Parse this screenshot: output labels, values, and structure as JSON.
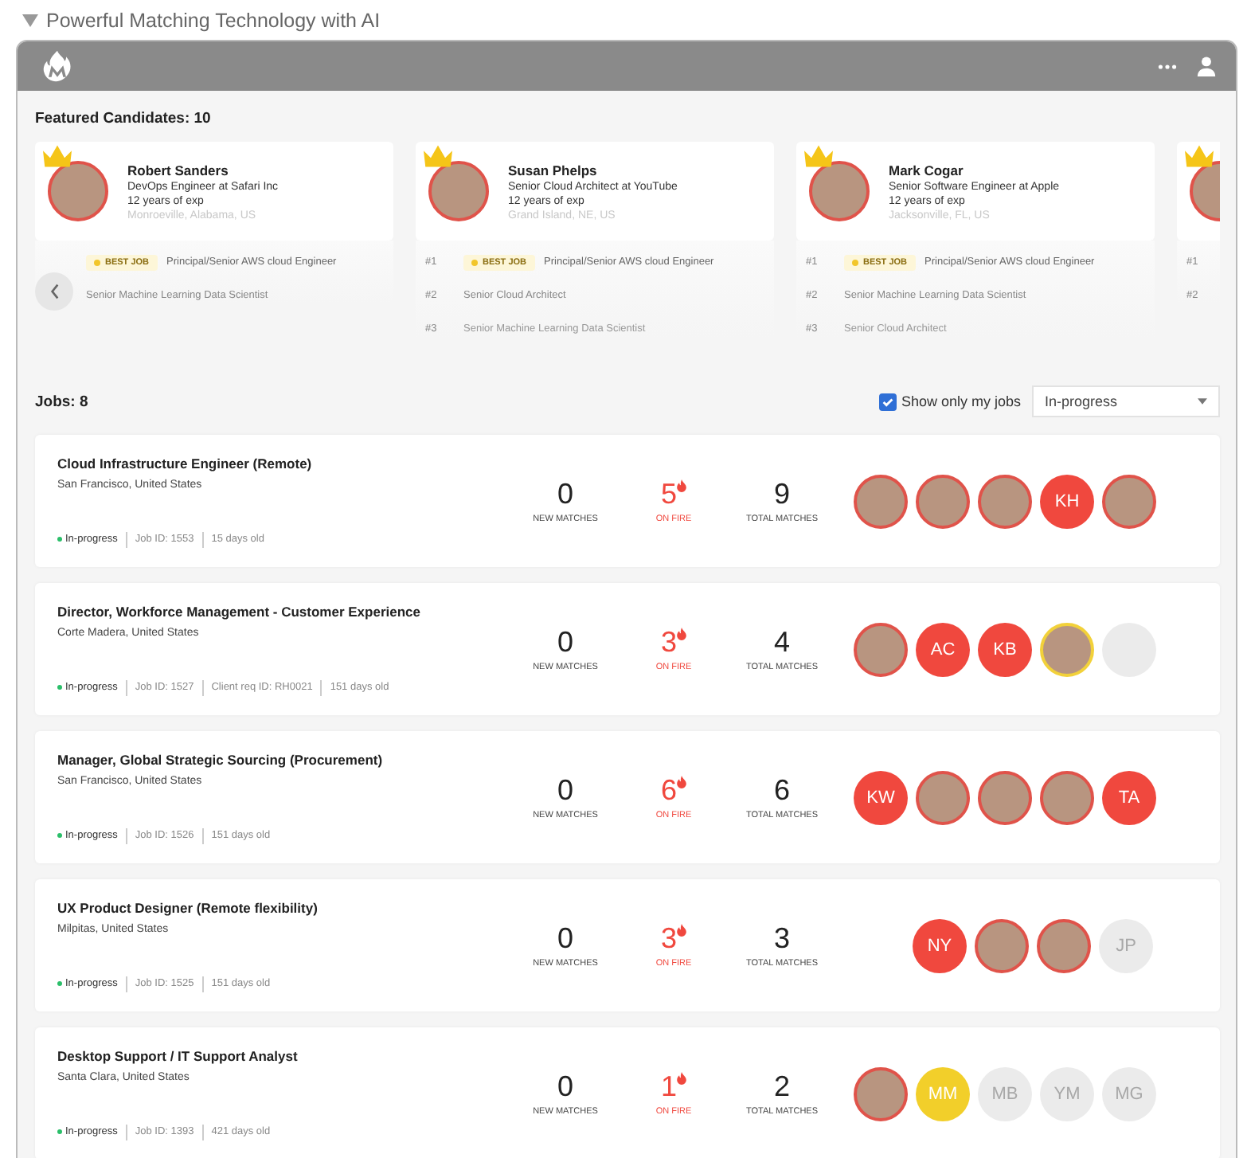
{
  "title": "Powerful Matching Technology with AI",
  "featured": {
    "label": "Featured Candidates: 10",
    "candidates": [
      {
        "name": "Robert Sanders",
        "headline": "DevOps Engineer at Safari Inc",
        "experience": "12 years of exp",
        "location": "Monroeville, Alabama, US",
        "jobs": [
          {
            "badge": "BEST JOB",
            "title": "Principal/Senior AWS cloud Engineer"
          },
          {
            "title": "Senior Machine Learning Data Scientist"
          }
        ]
      },
      {
        "name": "Susan Phelps",
        "headline": "Senior Cloud Architect at YouTube",
        "experience": "12 years of exp",
        "location": "Grand Island, NE, US",
        "jobs": [
          {
            "rank": "#1",
            "badge": "BEST JOB",
            "title": "Principal/Senior AWS cloud Engineer"
          },
          {
            "rank": "#2",
            "title": "Senior Cloud Architect"
          },
          {
            "rank": "#3",
            "title": "Senior Machine Learning Data Scientist"
          }
        ]
      },
      {
        "name": "Mark Cogar",
        "headline": "Senior Software Engineer at Apple",
        "experience": "12 years of exp",
        "location": "Jacksonville, FL, US",
        "jobs": [
          {
            "rank": "#1",
            "badge": "BEST JOB",
            "title": "Principal/Senior AWS cloud Engineer"
          },
          {
            "rank": "#2",
            "title": "Senior Machine Learning Data Scientist"
          },
          {
            "rank": "#3",
            "title": "Senior Cloud Architect"
          }
        ]
      },
      {
        "jobs": [
          {
            "rank": "#1"
          },
          {
            "rank": "#2"
          }
        ]
      }
    ]
  },
  "jobs": {
    "label": "Jobs: 8",
    "filter": {
      "label": "Show only my jobs",
      "checked": true
    },
    "status_select": {
      "value": "In-progress"
    },
    "list": [
      {
        "title": "Cloud Infrastructure Engineer (Remote)",
        "location": "San Francisco, United States",
        "status": "In-progress",
        "meta": [
          "Job ID: 1553",
          "15 days old"
        ],
        "stats": [
          {
            "kind": "new",
            "value": "0",
            "label": "NEW MATCHES"
          },
          {
            "kind": "fire",
            "value": "5",
            "label": "ON FIRE"
          },
          {
            "kind": "total",
            "value": "9",
            "label": "TOTAL MATCHES"
          }
        ],
        "avatars": [
          {
            "kind": "photo",
            "color": "#e0534a"
          },
          {
            "kind": "photo",
            "color": "#e0534a"
          },
          {
            "kind": "photo",
            "color": "#e0534a"
          },
          {
            "kind": "initials",
            "text": "KH",
            "color": "#f0483e"
          },
          {
            "kind": "photo",
            "color": "#e0534a"
          }
        ]
      },
      {
        "title": "Director, Workforce Management - Customer Experience",
        "location": "Corte Madera, United States",
        "status": "In-progress",
        "meta": [
          "Job ID: 1527",
          "Client req ID: RH0021",
          "151 days old"
        ],
        "stats": [
          {
            "kind": "new",
            "value": "0",
            "label": "NEW MATCHES"
          },
          {
            "kind": "fire",
            "value": "3",
            "label": "ON FIRE"
          },
          {
            "kind": "total",
            "value": "4",
            "label": "TOTAL MATCHES"
          }
        ],
        "avatars": [
          {
            "kind": "photo",
            "color": "#e0534a"
          },
          {
            "kind": "initials",
            "text": "AC",
            "color": "#f0483e"
          },
          {
            "kind": "initials",
            "text": "KB",
            "color": "#f0483e"
          },
          {
            "kind": "photo",
            "color": "#f2d13a"
          },
          {
            "kind": "placeholder"
          }
        ]
      },
      {
        "title": "Manager, Global Strategic Sourcing (Procurement)",
        "location": "San Francisco, United States",
        "status": "In-progress",
        "meta": [
          "Job ID: 1526",
          "151 days old"
        ],
        "stats": [
          {
            "kind": "new",
            "value": "0",
            "label": "NEW MATCHES"
          },
          {
            "kind": "fire",
            "value": "6",
            "label": "ON FIRE"
          },
          {
            "kind": "total",
            "value": "6",
            "label": "TOTAL MATCHES"
          }
        ],
        "avatars": [
          {
            "kind": "initials",
            "text": "KW",
            "color": "#f0483e"
          },
          {
            "kind": "photo",
            "color": "#e0534a"
          },
          {
            "kind": "photo",
            "color": "#e0534a"
          },
          {
            "kind": "photo",
            "color": "#e0534a"
          },
          {
            "kind": "initials",
            "text": "TA",
            "color": "#f0483e"
          }
        ]
      },
      {
        "title": "UX Product Designer (Remote flexibility)",
        "location": "Milpitas, United States",
        "status": "In-progress",
        "meta": [
          "Job ID: 1525",
          "151 days old"
        ],
        "stats": [
          {
            "kind": "new",
            "value": "0",
            "label": "NEW MATCHES"
          },
          {
            "kind": "fire",
            "value": "3",
            "label": "ON FIRE"
          },
          {
            "kind": "total",
            "value": "3",
            "label": "TOTAL MATCHES"
          }
        ],
        "avatars": [
          {
            "kind": "initials",
            "text": "NY",
            "color": "#f0483e"
          },
          {
            "kind": "photo",
            "color": "#e0534a"
          },
          {
            "kind": "photo",
            "color": "#e0534a"
          },
          {
            "kind": "faded",
            "text": "JP"
          }
        ]
      },
      {
        "title": "Desktop Support / IT Support Analyst",
        "location": "Santa Clara, United States",
        "status": "In-progress",
        "meta": [
          "Job ID: 1393",
          "421 days old"
        ],
        "stats": [
          {
            "kind": "new",
            "value": "0",
            "label": "NEW MATCHES"
          },
          {
            "kind": "fire",
            "value": "1",
            "label": "ON FIRE"
          },
          {
            "kind": "total",
            "value": "2",
            "label": "TOTAL MATCHES"
          }
        ],
        "avatars": [
          {
            "kind": "photo",
            "color": "#e0534a"
          },
          {
            "kind": "initials",
            "text": "MM",
            "color": "#f2cf2a"
          },
          {
            "kind": "faded",
            "text": "MB"
          },
          {
            "kind": "faded",
            "text": "YM"
          },
          {
            "kind": "faded",
            "text": "MG"
          }
        ]
      }
    ]
  }
}
